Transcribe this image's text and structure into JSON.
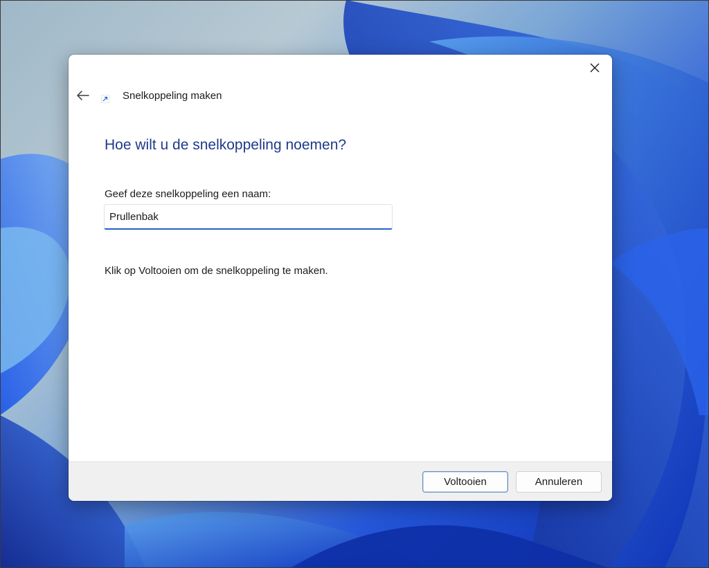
{
  "window": {
    "title": "Snelkoppeling maken",
    "close_icon": "close-icon",
    "back_icon": "back-arrow-icon",
    "shortcut_icon": "shortcut-arrow-icon"
  },
  "wizard": {
    "heading": "Hoe wilt u de snelkoppeling noemen?",
    "name_label": "Geef deze snelkoppeling een naam:",
    "name_value": "Prullenbak",
    "hint": "Klik op Voltooien om de snelkoppeling te maken."
  },
  "footer": {
    "finish_label": "Voltooien",
    "cancel_label": "Annuleren"
  },
  "colors": {
    "heading": "#1e3a8a",
    "input_accent": "#1e62c8",
    "wallpaper_blue": "#1d4fe0"
  }
}
